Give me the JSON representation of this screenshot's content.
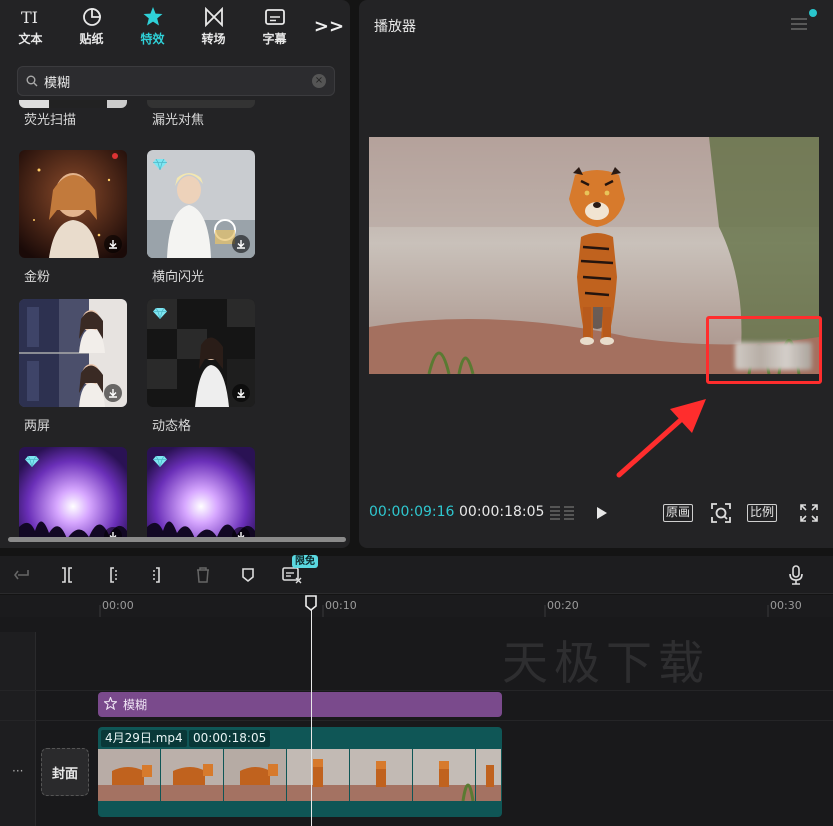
{
  "tabs": [
    {
      "label": "文本",
      "icon": "text-icon"
    },
    {
      "label": "贴纸",
      "icon": "sticker-icon"
    },
    {
      "label": "特效",
      "icon": "effects-star-icon"
    },
    {
      "label": "转场",
      "icon": "transition-icon"
    },
    {
      "label": "字幕",
      "icon": "subtitle-icon"
    }
  ],
  "tab_more": ">>",
  "active_tab": "特效",
  "search": {
    "value": "模糊"
  },
  "effects": [
    {
      "name": "荧光扫描",
      "premium": false
    },
    {
      "name": "漏光对焦",
      "premium": false
    },
    {
      "name": "金粉",
      "premium": false
    },
    {
      "name": "横向闪光",
      "premium": true
    },
    {
      "name": "两屏",
      "premium": false
    },
    {
      "name": "动态格",
      "premium": true
    },
    {
      "name": "",
      "premium": true
    },
    {
      "name": "",
      "premium": true
    }
  ],
  "player": {
    "title": "播放器",
    "current_time": "00:00:09:16",
    "total_time": "00:00:18:05",
    "btn_original": "原画",
    "btn_ratio": "比例"
  },
  "toolbar": {
    "badge": "限免"
  },
  "ruler": [
    "00:00",
    "00:10",
    "00:20",
    "00:30"
  ],
  "watermark": "天极下载",
  "timeline": {
    "effect_clip": "模糊",
    "video_clip_name": "4月29日.mp4",
    "video_clip_duration": "00:00:18:05",
    "cover_label": "封面",
    "more": "···"
  },
  "colors": {
    "accent": "#2fd1d8",
    "highlight": "#ff2d2d",
    "effect_clip": "#7a4a8c",
    "video_clip": "#0f5656"
  }
}
